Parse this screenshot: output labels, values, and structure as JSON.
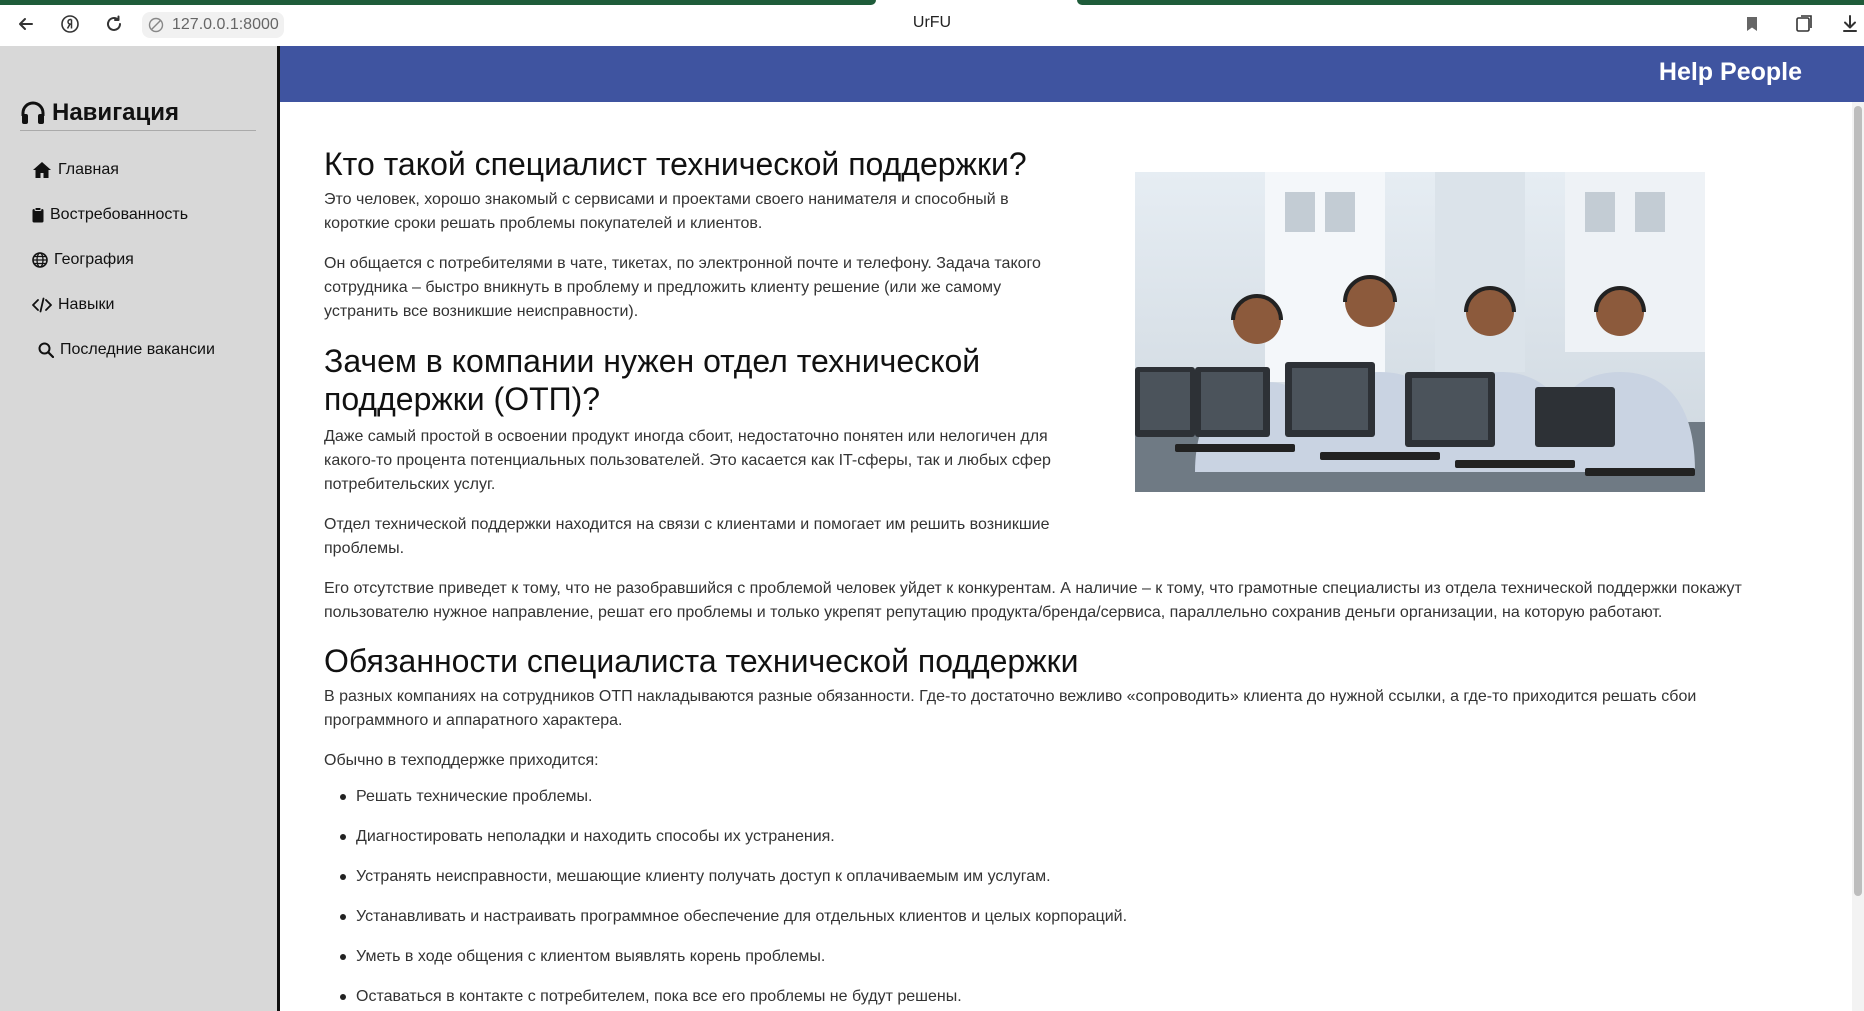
{
  "browser": {
    "url": "127.0.0.1:8000",
    "tab_title": "UrFU",
    "accent_color": "#1f5c3a"
  },
  "sidebar": {
    "title": "Навигация",
    "items": [
      {
        "label": "Главная",
        "icon": "home-icon"
      },
      {
        "label": "Востребованность",
        "icon": "clipboard-icon"
      },
      {
        "label": "География",
        "icon": "globe-icon"
      },
      {
        "label": "Навыки",
        "icon": "code-icon"
      },
      {
        "label": "Последние вакансии",
        "icon": "search-icon"
      }
    ]
  },
  "header": {
    "brand": "Help People",
    "color": "#3f54a0"
  },
  "main": {
    "h1": "Кто такой специалист технической поддержки?",
    "p1": "Это человек, хорошо знакомый с сервисами и проектами своего нанимателя и способный в короткие сроки решать проблемы покупателей и клиентов.",
    "p2": "Он общается с потребителями в чате, тикетах, по электронной почте и телефону. Задача такого сотрудника – быстро вникнуть в проблему и предложить клиенту решение (или же самому устранить все возникшие неисправности).",
    "h2": "Зачем в компании нужен отдел технической поддержки (ОТП)?",
    "p3": "Даже самый простой в освоении продукт иногда сбоит, недостаточно понятен или нелогичен для какого-то процента потенциальных пользователей. Это касается как IT-сферы, так и любых сфер потребительских услуг.",
    "p4": "Отдел технической поддержки находится на связи с клиентами и помогает им решить возникшие проблемы.",
    "p5": "Его отсутствие приведет к тому, что не разобравшийся с проблемой человек уйдет к конкурентам. А наличие – к тому, что грамотные специалисты из отдела технической поддержки покажут пользователю нужное направление, решат его проблемы и только укрепят репутацию продукта/бренда/сервиса, параллельно сохранив деньги организации, на которую работают.",
    "h3": "Обязанности специалиста технической поддержки",
    "p6": "В разных компаниях на сотрудников ОТП накладываются разные обязанности. Где-то достаточно вежливо «сопроводить» клиента до нужной ссылки, а где-то приходится решать сбои программного и аппаратного характера.",
    "p7": "Обычно в техподдержке приходится:",
    "bullets": [
      "Решать технические проблемы.",
      "Диагностировать неполадки и находить способы их устранения.",
      "Устранять неисправности, мешающие клиенту получать доступ к оплачиваемым им услугам.",
      "Устанавливать и настраивать программное обеспечение для отдельных клиентов и целых корпораций.",
      "Уметь в ходе общения с клиентом выявлять корень проблемы.",
      "Оставаться в контакте с потребителем, пока все его проблемы не будут решены."
    ]
  }
}
